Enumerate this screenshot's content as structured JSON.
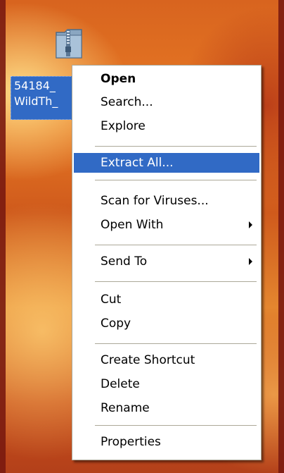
{
  "desktop": {
    "file": {
      "icon": "zip-folder-icon",
      "label_line1": "54184_",
      "label_line2": "WildTh_"
    }
  },
  "context_menu": {
    "highlight_color": "#316ac5",
    "items": [
      {
        "label": "Open",
        "bold": true
      },
      {
        "label": "Search..."
      },
      {
        "label": "Explore"
      },
      {
        "label": "Extract All...",
        "highlighted": true
      },
      {
        "label": "Scan for Viruses..."
      },
      {
        "label": "Open With",
        "submenu": true
      },
      {
        "label": "Send To",
        "submenu": true
      },
      {
        "label": "Cut"
      },
      {
        "label": "Copy"
      },
      {
        "label": "Create Shortcut"
      },
      {
        "label": "Delete"
      },
      {
        "label": "Rename"
      },
      {
        "label": "Properties"
      }
    ]
  }
}
